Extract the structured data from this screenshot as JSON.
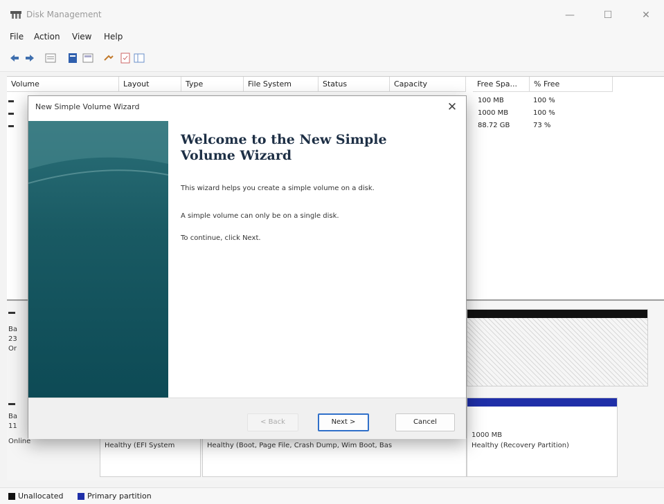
{
  "window": {
    "title": "Disk Management",
    "controls": {
      "minimize": "—",
      "maximize": "☐",
      "close": "✕"
    }
  },
  "menu": [
    "File",
    "Action",
    "View",
    "Help"
  ],
  "toolbar": {
    "icons": [
      "back-icon",
      "forward-icon",
      "list-view-icon",
      "properties-icon",
      "help-icon",
      "map-view-icon",
      "pin-icon",
      "check-icon",
      "panel-icon"
    ]
  },
  "volume_list": {
    "columns": [
      "Volume",
      "Layout",
      "Type",
      "File System",
      "Status",
      "Capacity",
      "Free Spa...",
      "% Free"
    ],
    "rows": [
      {
        "free_space": "100 MB",
        "percent_free": "100 %"
      },
      {
        "free_space": "1000 MB",
        "percent_free": "100 %"
      },
      {
        "free_space": "88.72 GB",
        "percent_free": "73 %"
      }
    ]
  },
  "disk_map": {
    "disk0": {
      "label_lines": [
        "Ba",
        "23",
        "Or"
      ]
    },
    "disk1": {
      "label_lines": [
        "Ba",
        "11",
        "Online"
      ],
      "partitions": [
        {
          "status": "Healthy (EFI System"
        },
        {
          "status": "Healthy (Boot, Page File, Crash Dump, Wim Boot, Bas"
        },
        {
          "size": "1000 MB",
          "status": "Healthy (Recovery Partition)"
        }
      ]
    }
  },
  "legend": [
    {
      "label": "Unallocated",
      "color": "#111111"
    },
    {
      "label": "Primary partition",
      "color": "#1f2fa8"
    }
  ],
  "wizard": {
    "title": "New Simple Volume Wizard",
    "close": "✕",
    "heading": "Welcome to the New Simple Volume Wizard",
    "paragraphs": [
      "This wizard helps you create a simple volume on a disk.",
      "A simple volume can only be on a single disk.",
      "To continue, click Next."
    ],
    "buttons": {
      "back": "< Back",
      "next": "Next >",
      "cancel": "Cancel"
    }
  },
  "colors": {
    "primary_partition_bar": "#1f2fa8",
    "unallocated_bar": "#111111",
    "wizard_side_panel": "#195a63"
  }
}
